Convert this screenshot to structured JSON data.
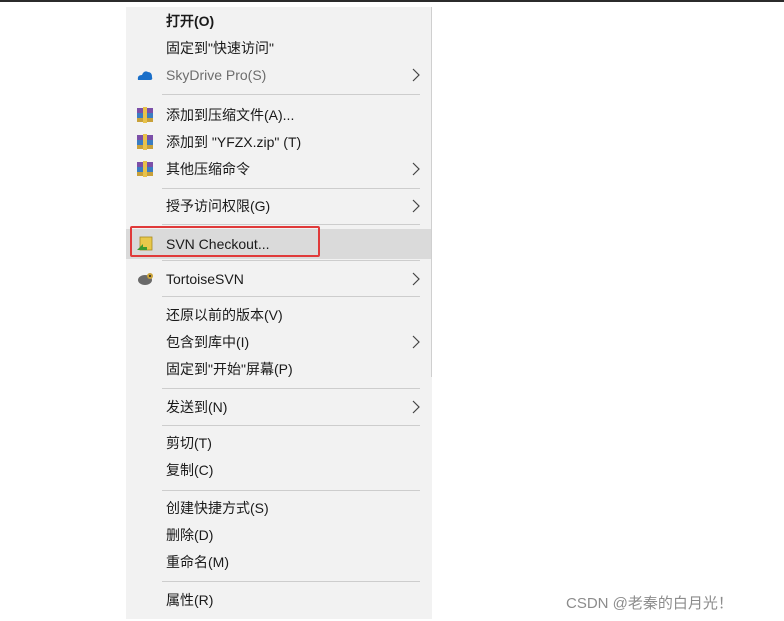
{
  "context_menu": {
    "items": [
      {
        "label": "打开(O)",
        "bold": true
      },
      {
        "label": "固定到\"快速访问\""
      },
      {
        "label": "SkyDrive Pro(S)",
        "icon": "skydrive-cloud-icon",
        "submenu": true
      },
      {
        "label": "添加到压缩文件(A)...",
        "icon": "winrar-icon"
      },
      {
        "label": "添加到 \"YFZX.zip\" (T)",
        "icon": "winrar-icon"
      },
      {
        "label": "其他压缩命令",
        "icon": "winrar-icon",
        "submenu": true
      },
      {
        "label": "授予访问权限(G)",
        "submenu": true
      },
      {
        "label": "SVN Checkout...",
        "icon": "svn-checkout-icon",
        "highlighted": true
      },
      {
        "label": "TortoiseSVN",
        "icon": "tortoisesvn-icon",
        "submenu": true
      },
      {
        "label": "还原以前的版本(V)"
      },
      {
        "label": "包含到库中(I)",
        "submenu": true
      },
      {
        "label": "固定到\"开始\"屏幕(P)"
      },
      {
        "label": "发送到(N)",
        "submenu": true
      },
      {
        "label": "剪切(T)"
      },
      {
        "label": "复制(C)"
      },
      {
        "label": "创建快捷方式(S)"
      },
      {
        "label": "删除(D)"
      },
      {
        "label": "重命名(M)"
      },
      {
        "label": "属性(R)"
      }
    ]
  },
  "watermark": "CSDN @老秦的白月光！",
  "colors": {
    "menu_background": "#f2f2f2",
    "hover_background": "#dadada",
    "annotation_box": "#e03a3a",
    "separator": "#cdcdcd"
  }
}
